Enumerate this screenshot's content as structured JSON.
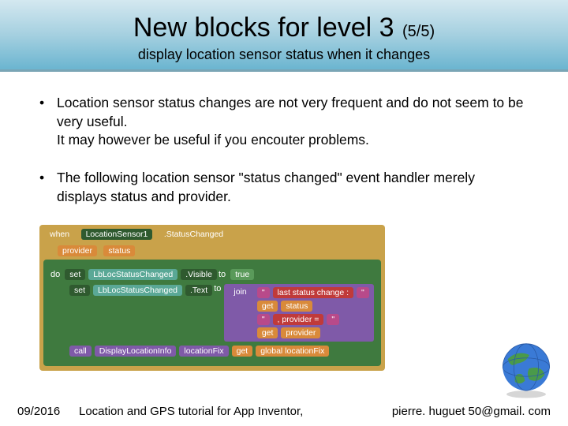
{
  "header": {
    "title_main": "New blocks for level 3",
    "title_page": "(5/5)",
    "subtitle": "display location sensor status when it changes"
  },
  "bullets": [
    "Location sensor status changes are not very frequent and do not seem to be very useful.\nIt may however be useful if you encouter problems.",
    "The following location sensor \"status changed\"  event handler merely displays status and provider."
  ],
  "blocks": {
    "when": "when",
    "sensor": "LocationSensor1",
    "event": ".StatusChanged",
    "params": [
      "provider",
      "status"
    ],
    "do": "do",
    "set1": {
      "set": "set",
      "target": "LbLocStatusChanged",
      "prop": ".Visible",
      "to": "to",
      "val": "true"
    },
    "set2": {
      "set": "set",
      "target": "LbLocStatusChanged",
      "prop": ".Text",
      "to": "to",
      "join": "join",
      "lines": [
        {
          "left": "\"",
          "mid": "last status change :",
          "right": "\""
        },
        {
          "get": "get",
          "var": "status"
        },
        {
          "left": "\"",
          "mid": ", provider =",
          "right": "\""
        },
        {
          "get": "get",
          "var": "provider"
        }
      ]
    },
    "call": {
      "call": "call",
      "proc": "DisplayLocationInfo",
      "arg": "locationFix",
      "get": "get",
      "gvar": "global locationFix"
    }
  },
  "footer": {
    "date": "09/2016",
    "title": "Location and GPS tutorial for App Inventor,",
    "email": "pierre. huguet 50@gmail. com"
  }
}
